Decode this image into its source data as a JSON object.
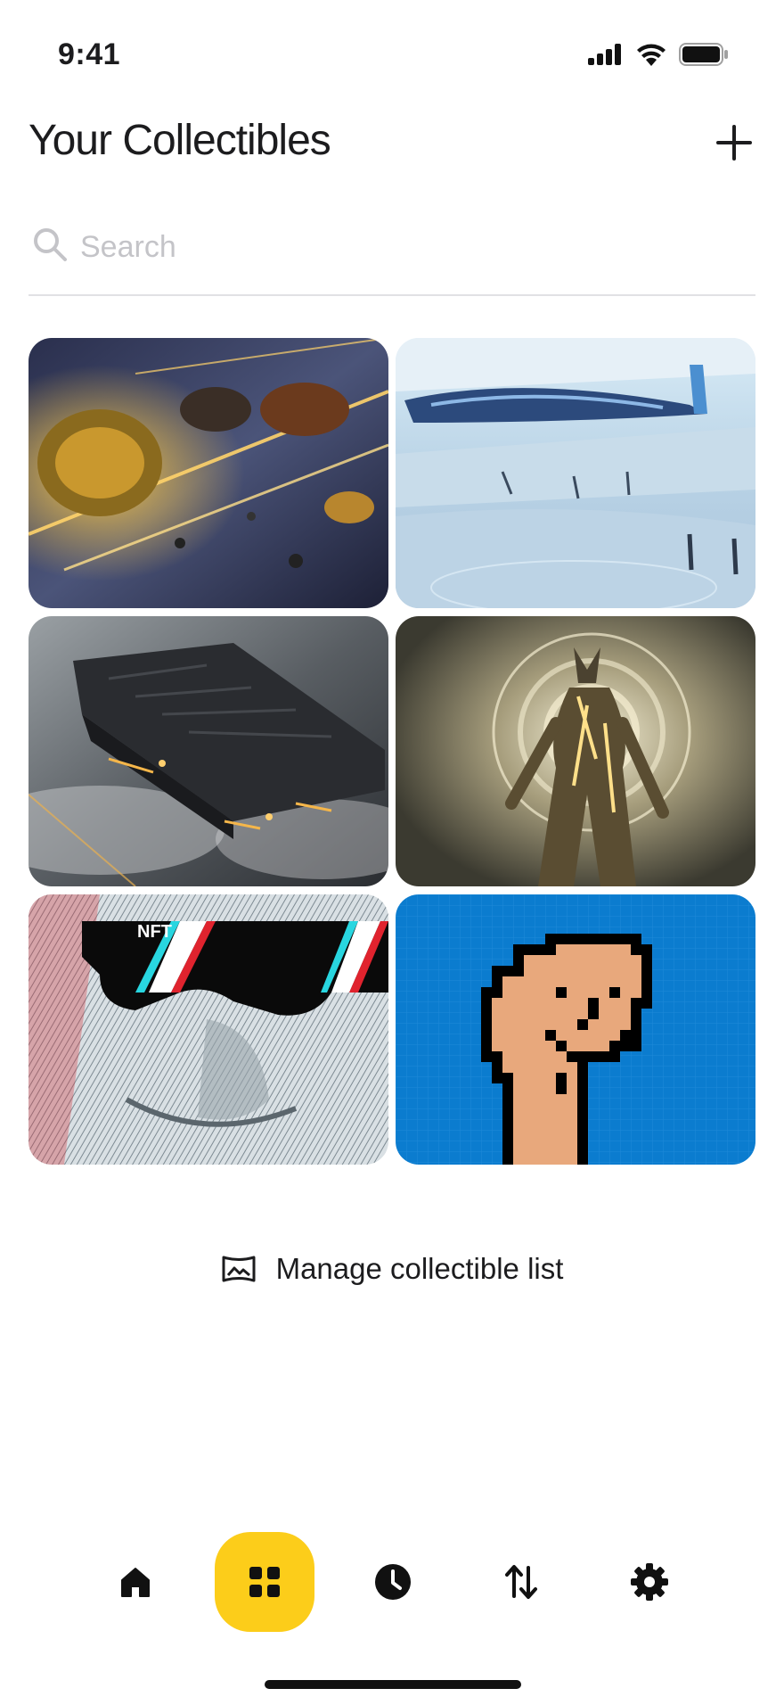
{
  "status_bar": {
    "time": "9:41"
  },
  "header": {
    "title": "Your Collectibles",
    "add_icon": "plus-icon"
  },
  "search": {
    "placeholder": "Search",
    "value": ""
  },
  "collectibles": [
    {
      "art": "space-battle-ships"
    },
    {
      "art": "futuristic-spaceport"
    },
    {
      "art": "dark-monolith-ship"
    },
    {
      "art": "glowing-golden-being"
    },
    {
      "art": "nft-glasses-portrait",
      "overlay_text": "NFT"
    },
    {
      "art": "pixel-punk-face"
    }
  ],
  "manage": {
    "label": "Manage collectible list",
    "icon": "image-frame-icon"
  },
  "nav": {
    "items": [
      {
        "icon": "home-icon"
      },
      {
        "icon": "grid-icon",
        "active": true
      },
      {
        "icon": "clock-icon"
      },
      {
        "icon": "transfer-arrows-icon"
      },
      {
        "icon": "gear-icon"
      }
    ]
  },
  "colors": {
    "accent": "#fccd1a",
    "text": "#1c1c1e",
    "placeholder": "#c4c4c8",
    "divider": "#e1e1e4"
  }
}
